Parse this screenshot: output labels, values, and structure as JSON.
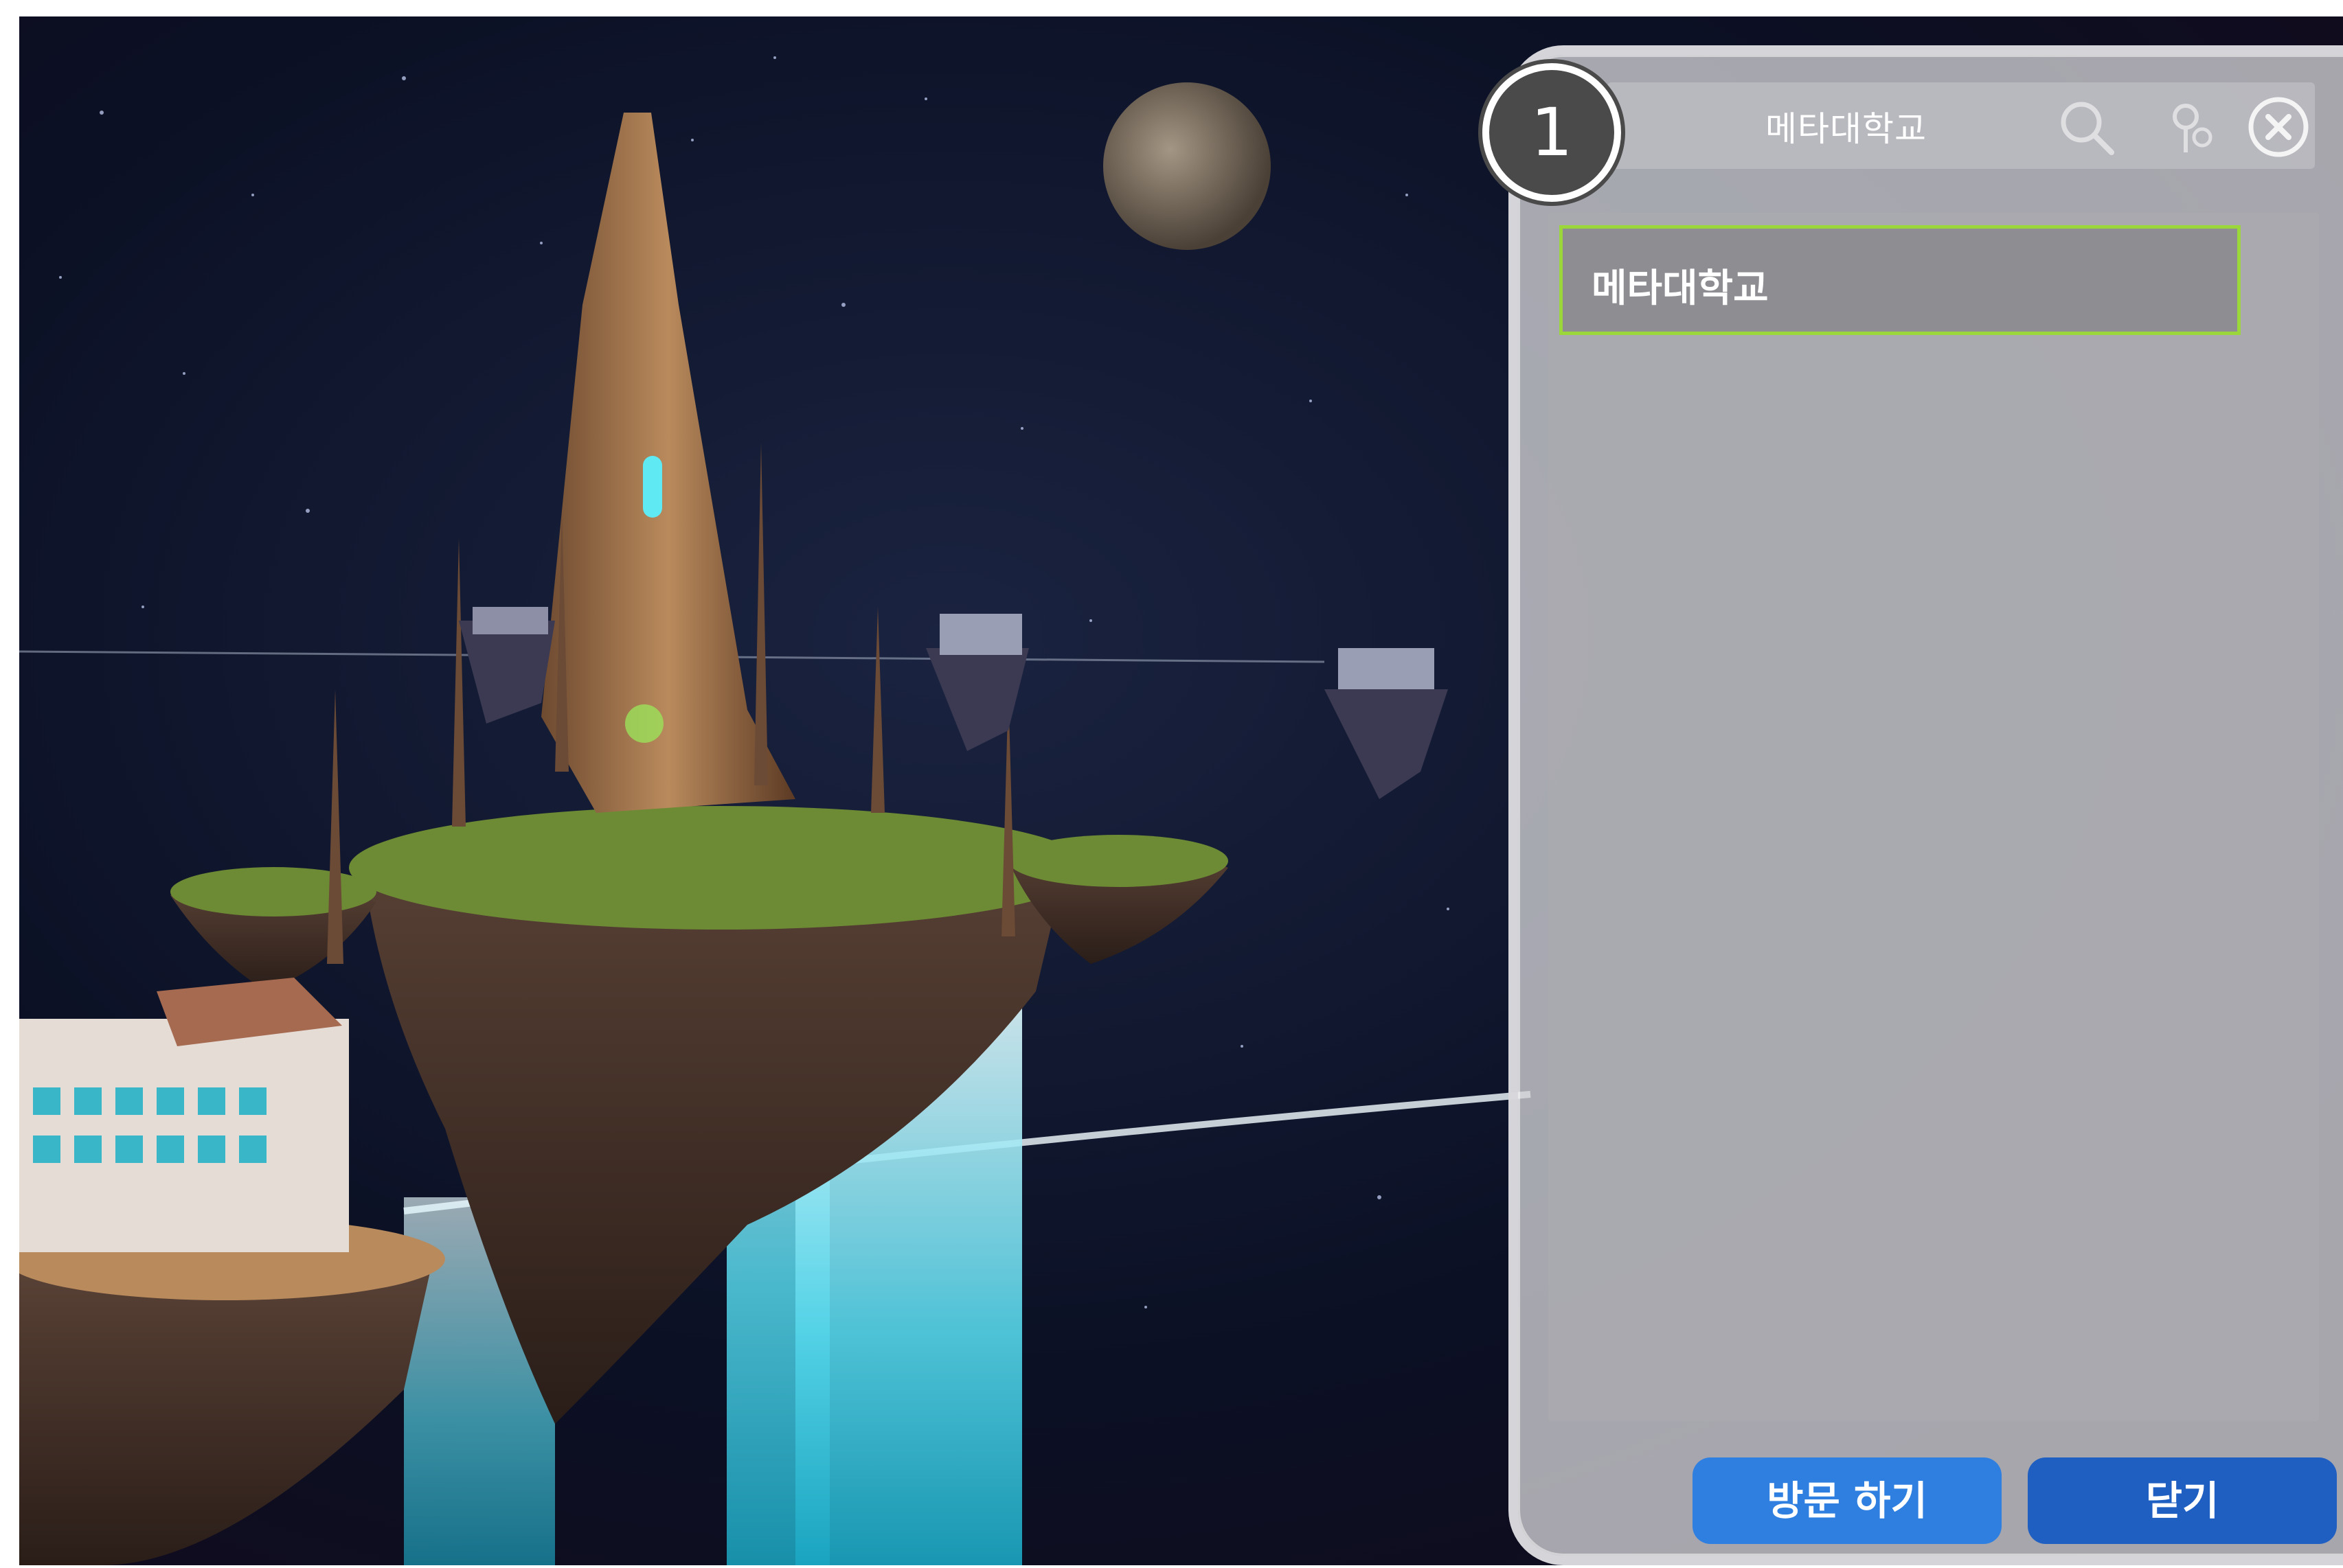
{
  "step_badge": "1",
  "panel": {
    "header_title": "메타대학교",
    "header_icons": [
      "search-icon",
      "location-icon",
      "close-icon"
    ],
    "list_items": [
      {
        "label": "메타대학교",
        "selected": true
      }
    ],
    "buttons": {
      "visit": "방문 하기",
      "close": "닫기"
    }
  },
  "colors": {
    "selected_border": "#9bd73a",
    "visit_button": "#2e7fe0",
    "close_button": "#1f5fc2"
  }
}
